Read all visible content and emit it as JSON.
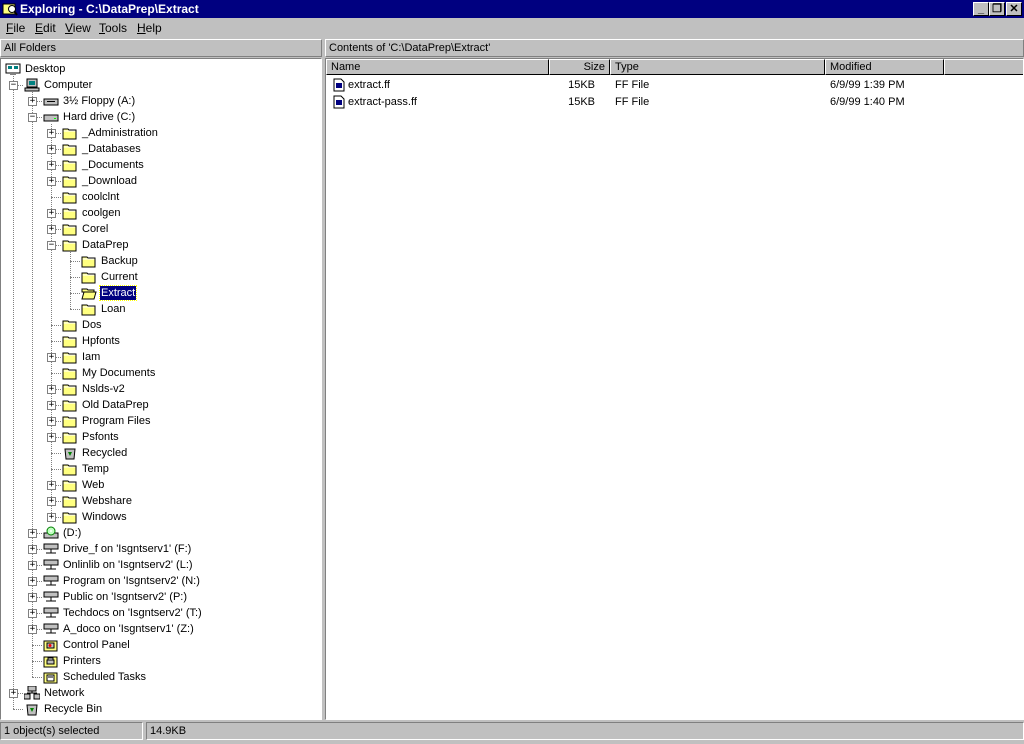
{
  "window": {
    "title": "Exploring - C:\\DataPrep\\Extract",
    "min_label": "_",
    "restore_label": "❐",
    "close_label": "✕"
  },
  "menu": [
    {
      "key": "F",
      "rest": "ile"
    },
    {
      "key": "E",
      "rest": "dit"
    },
    {
      "key": "V",
      "rest": "iew"
    },
    {
      "key": "T",
      "rest": "ools"
    },
    {
      "key": "H",
      "rest": "elp"
    }
  ],
  "left_header": "All Folders",
  "right_header": "Contents of 'C:\\DataPrep\\Extract'",
  "tree": [
    {
      "label": "Desktop",
      "level": 0,
      "icon": "desktop-icon",
      "toggle": ""
    },
    {
      "label": "Computer",
      "level": 1,
      "icon": "computer-icon",
      "toggle": "-"
    },
    {
      "label": "3½ Floppy (A:)",
      "level": 2,
      "icon": "floppy-drive-icon",
      "toggle": "+"
    },
    {
      "label": "Hard drive (C:)",
      "level": 2,
      "icon": "hard-drive-icon",
      "toggle": "-"
    },
    {
      "label": "_Administration",
      "level": 3,
      "icon": "folder-icon",
      "toggle": "+"
    },
    {
      "label": "_Databases",
      "level": 3,
      "icon": "folder-icon",
      "toggle": "+"
    },
    {
      "label": "_Documents",
      "level": 3,
      "icon": "folder-icon",
      "toggle": "+"
    },
    {
      "label": "_Download",
      "level": 3,
      "icon": "folder-icon",
      "toggle": "+"
    },
    {
      "label": "coolclnt",
      "level": 3,
      "icon": "folder-icon",
      "toggle": ""
    },
    {
      "label": "coolgen",
      "level": 3,
      "icon": "folder-icon",
      "toggle": "+"
    },
    {
      "label": "Corel",
      "level": 3,
      "icon": "folder-icon",
      "toggle": "+"
    },
    {
      "label": "DataPrep",
      "level": 3,
      "icon": "folder-icon",
      "toggle": "-"
    },
    {
      "label": "Backup",
      "level": 4,
      "icon": "folder-icon",
      "toggle": ""
    },
    {
      "label": "Current",
      "level": 4,
      "icon": "folder-icon",
      "toggle": ""
    },
    {
      "label": "Extract",
      "level": 4,
      "icon": "open-folder-icon",
      "toggle": "",
      "selected": true
    },
    {
      "label": "Loan",
      "level": 4,
      "icon": "folder-icon",
      "toggle": ""
    },
    {
      "label": "Dos",
      "level": 3,
      "icon": "folder-icon",
      "toggle": ""
    },
    {
      "label": "Hpfonts",
      "level": 3,
      "icon": "folder-icon",
      "toggle": ""
    },
    {
      "label": "Iam",
      "level": 3,
      "icon": "folder-icon",
      "toggle": "+"
    },
    {
      "label": "My Documents",
      "level": 3,
      "icon": "folder-icon",
      "toggle": ""
    },
    {
      "label": "Nslds-v2",
      "level": 3,
      "icon": "folder-icon",
      "toggle": "+"
    },
    {
      "label": "Old DataPrep",
      "level": 3,
      "icon": "folder-icon",
      "toggle": "+"
    },
    {
      "label": "Program Files",
      "level": 3,
      "icon": "folder-icon",
      "toggle": "+"
    },
    {
      "label": "Psfonts",
      "level": 3,
      "icon": "folder-icon",
      "toggle": "+"
    },
    {
      "label": "Recycled",
      "level": 3,
      "icon": "recycle-bin-icon",
      "toggle": ""
    },
    {
      "label": "Temp",
      "level": 3,
      "icon": "folder-icon",
      "toggle": ""
    },
    {
      "label": "Web",
      "level": 3,
      "icon": "folder-icon",
      "toggle": "+"
    },
    {
      "label": "Webshare",
      "level": 3,
      "icon": "folder-icon",
      "toggle": "+"
    },
    {
      "label": "Windows",
      "level": 3,
      "icon": "folder-icon",
      "toggle": "+"
    },
    {
      "label": "(D:)",
      "level": 2,
      "icon": "cd-drive-icon",
      "toggle": "+"
    },
    {
      "label": "Drive_f on 'Isgntserv1' (F:)",
      "level": 2,
      "icon": "network-drive-icon",
      "toggle": "+"
    },
    {
      "label": "Onlinlib on 'Isgntserv2' (L:)",
      "level": 2,
      "icon": "network-drive-icon",
      "toggle": "+"
    },
    {
      "label": "Program on 'Isgntserv2' (N:)",
      "level": 2,
      "icon": "network-drive-icon",
      "toggle": "+"
    },
    {
      "label": "Public on 'Isgntserv2' (P:)",
      "level": 2,
      "icon": "network-drive-icon",
      "toggle": "+"
    },
    {
      "label": "Techdocs on 'Isgntserv2' (T:)",
      "level": 2,
      "icon": "network-drive-icon",
      "toggle": "+"
    },
    {
      "label": "A_doco on 'Isgntserv1' (Z:)",
      "level": 2,
      "icon": "network-drive-icon",
      "toggle": "+"
    },
    {
      "label": "Control Panel",
      "level": 2,
      "icon": "control-panel-icon",
      "toggle": ""
    },
    {
      "label": "Printers",
      "level": 2,
      "icon": "printers-icon",
      "toggle": ""
    },
    {
      "label": "Scheduled Tasks",
      "level": 2,
      "icon": "scheduled-tasks-icon",
      "toggle": ""
    },
    {
      "label": "Network",
      "level": 1,
      "icon": "network-icon",
      "toggle": "+"
    },
    {
      "label": "Recycle Bin",
      "level": 1,
      "icon": "recycle-bin-icon",
      "toggle": ""
    }
  ],
  "columns": {
    "name": "Name",
    "size": "Size",
    "type": "Type",
    "modified": "Modified"
  },
  "files": [
    {
      "name": "extract.ff",
      "size": "15KB",
      "type": "FF File",
      "modified": "6/9/99 1:39 PM",
      "icon": "file-icon"
    },
    {
      "name": "extract-pass.ff",
      "size": "15KB",
      "type": "FF File",
      "modified": "6/9/99 1:40 PM",
      "icon": "file-icon"
    }
  ],
  "status": {
    "selection": "1 object(s) selected",
    "size": "14.9KB"
  },
  "colors": {
    "titlebar": "#000080",
    "face": "#c0c0c0",
    "folder": "#ffff80",
    "selection": "#000080"
  }
}
